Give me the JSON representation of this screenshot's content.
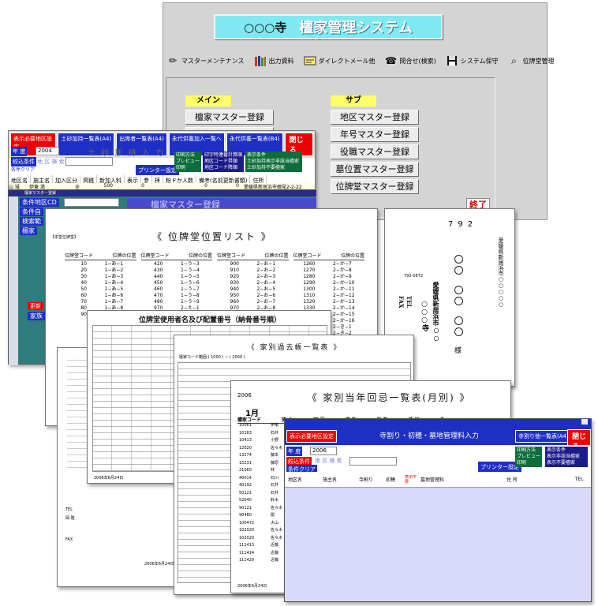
{
  "main": {
    "temple": "○○○寺",
    "system_title": "檀家管理システム",
    "menu": [
      {
        "icon": "pencil-icon",
        "label": "マスターメンテナンス"
      },
      {
        "icon": "books-icon",
        "label": "出力資料"
      },
      {
        "icon": "mail-icon",
        "label": "ダイレクトメール他"
      },
      {
        "icon": "phone-icon",
        "label": "問合せ(検索)"
      },
      {
        "icon": "floppy-icon",
        "label": "システム保守"
      },
      {
        "icon": "search-icon",
        "label": "位牌堂管理"
      }
    ],
    "main_section": "メイン",
    "main_buttons": [
      "檀家マスター登録",
      "寺家マスター登録"
    ],
    "sub_section": "サブ",
    "sub_buttons": [
      "地区マスター登録",
      "年号マスター登録",
      "役職マスター登録",
      "墓位置マスター登録",
      "位牌堂マスター登録"
    ],
    "exit": "終了"
  },
  "earth_form": {
    "toolbar": [
      "表示必要地区設定",
      "土砂加持一覧表(A4)",
      "出席者一覧表(A4)",
      "永代供養加入一覧へ",
      "永代供養一覧表(B4)"
    ],
    "close": "閉じる",
    "year_label": "年 度",
    "year_value": "2004",
    "title": "土 砂 加 持 入 力",
    "narrow_label": "絞込条件",
    "narrow_clear": "条件クリア",
    "district_label": "地 区 検 索",
    "printer_btn": "プリンター設定",
    "print_method": "印刷方法",
    "print_opts": [
      "プレビュー",
      "印刷"
    ],
    "code_opts_title": "印字時連番計算順",
    "code_opts": [
      "地区コード昇順",
      "地区コード降順"
    ],
    "display_title": "表示条件",
    "display_opts": [
      "土砂加持表示非該当檀家",
      "土砂加持不要檀家"
    ],
    "columns": [
      "地区名",
      "施主名",
      "加入区分",
      "冥銭",
      "新加入料",
      "表示",
      "参",
      "拝",
      "粉ドか人数",
      "備考(名前更新書類)",
      "住所"
    ],
    "row": {
      "district": "山 城",
      "name": "伊東 満",
      "kubun": "全",
      "amount": "500",
      "newfee": "0",
      "zero": "0",
      "zero2": "0",
      "address": "愛媛県新居浜市郷見2-2-22"
    },
    "side": [
      "山城",
      "山城",
      "山城",
      "山城",
      "山城"
    ]
  },
  "master_form": {
    "title": "檀家マスター登録",
    "district_cd": "条件地区CD",
    "cond": "条件自",
    "search": "検索範",
    "danka": "檀家",
    "header_label": "檀家マスター登録",
    "btn_red": "更新",
    "btn_blue": "家族"
  },
  "ihai_list": {
    "tag": "【本堂位牌堂】",
    "title": "《 位牌堂位置リスト 》",
    "col_code": "位牌堂コード",
    "col_pos": "位牌の位置",
    "cols": [
      [
        [
          "10",
          "1−あ−1"
        ],
        [
          "20",
          "1−あ−2"
        ],
        [
          "30",
          "1−あ−3"
        ],
        [
          "40",
          "1−あ−4"
        ],
        [
          "50",
          "1−あ−5"
        ],
        [
          "60",
          "1−あ−6"
        ],
        [
          "70",
          "1−あ−7"
        ],
        [
          "80",
          "1−あ−8"
        ],
        [
          "90",
          ""
        ]
      ],
      [
        [
          "420",
          "1−う−3"
        ],
        [
          "430",
          "1−う−4"
        ],
        [
          "440",
          "1−う−5"
        ],
        [
          "450",
          "1−う−6"
        ],
        [
          "460",
          "1−う−7"
        ],
        [
          "470",
          "1−う−8"
        ],
        [
          "480",
          "1−う−9"
        ],
        [
          "970",
          "2−え−1"
        ],
        [
          "",
          ""
        ]
      ],
      [
        [
          "900",
          "2−お−1"
        ],
        [
          "910",
          "2−お−2"
        ],
        [
          "920",
          "2−お−3"
        ],
        [
          "930",
          "2−お−4"
        ],
        [
          "940",
          "2−お−5"
        ],
        [
          "950",
          "2−お−6"
        ],
        [
          "960",
          "2−お−7"
        ],
        [
          "970",
          "2−お−8"
        ],
        [
          "",
          ""
        ]
      ],
      [
        [
          "1260",
          "2−か−7"
        ],
        [
          "1270",
          "2−か−8"
        ],
        [
          "1280",
          "2−か−9"
        ],
        [
          "1290",
          "2−か−10"
        ],
        [
          "1300",
          "2−か−11"
        ],
        [
          "1310",
          "2−か−12"
        ],
        [
          "1320",
          "2−か−13"
        ],
        [
          "1330",
          "2−か−14"
        ],
        [
          "",
          "2−か−15"
        ],
        [
          "",
          "2−か−16"
        ],
        [
          "",
          "2−き−1"
        ],
        [
          "",
          "2−き−2"
        ],
        [
          "",
          "2−き−3"
        ],
        [
          "",
          "2−き−4"
        ]
      ]
    ]
  },
  "envelope": {
    "zip": "792",
    "address": "愛媛県新居浜市○○○○○",
    "temple": "○○○寺",
    "temple_addr": "愛媛県新居浜市○○",
    "zip2": "792-0872",
    "tel": "TEL",
    "fax": "FAX",
    "sama": "様"
  },
  "ihai_users": {
    "title": "位牌堂使用者名及び配置番号（納骨番号順）",
    "date": "2006年6月24日"
  },
  "family_list": {
    "title": "《 家別過去帳一覧表 》",
    "sub": "檀家コード範囲 ( 1000 ) ~ ( 2000 )",
    "sub_tag": "10002 伊藤 フクヨ"
  },
  "annual": {
    "year": "2006",
    "title": "《 家別当年回忌一覧表(月別) 》",
    "month": "1月",
    "cols": [
      "檀家コード",
      "施 主",
      "回 忌",
      "戒 名",
      "俗 名",
      "続 柄",
      "命"
    ],
    "codes": [
      "10061",
      "10183",
      "10413",
      "12020",
      "13274",
      "15231",
      "21060",
      "40014",
      "40192",
      "50121",
      "52040",
      "90121",
      "90480",
      "100472",
      "102020",
      "102020",
      "111413",
      "111414",
      "111420"
    ],
    "names": [
      "伊東",
      "石井",
      "小野",
      "佐々木",
      "藤本",
      "藤原",
      "林",
      "石川",
      "石井",
      "石井",
      "鈴木",
      "佐々木",
      "関",
      "大山",
      "佐々木",
      "佐々木",
      "近藤",
      "近藤",
      "近藤"
    ],
    "date": "2006年6月24日"
  },
  "left_papers": {
    "labels": [
      "TEL",
      "FAX"
    ],
    "date": "2006年6月24日",
    "person": "岡 隆"
  },
  "front": {
    "title": "寺割り・初穂・墓地管理料入力",
    "toolbar_left": "表示必要地区設定",
    "toolbar_right": "寺割り他一覧表(A4)",
    "close": "閉じる",
    "year_label": "年 度",
    "year_value": "2006",
    "narrow_label": "絞込条件",
    "narrow_clear": "条件クリア",
    "district_label": "地 区 検 索",
    "printer_btn": "プリンター設定",
    "print_method": "印刷方法",
    "print_opts": [
      "プレビュー",
      "印刷"
    ],
    "display_title": "表示条件",
    "display_opts": [
      "表示非該当檀家",
      "表示不要檀家"
    ],
    "columns": [
      "地区名",
      "施主名",
      "寺割り",
      "初穂",
      "表示不要",
      "墓地管理料",
      "住 所",
      "TEL"
    ]
  }
}
